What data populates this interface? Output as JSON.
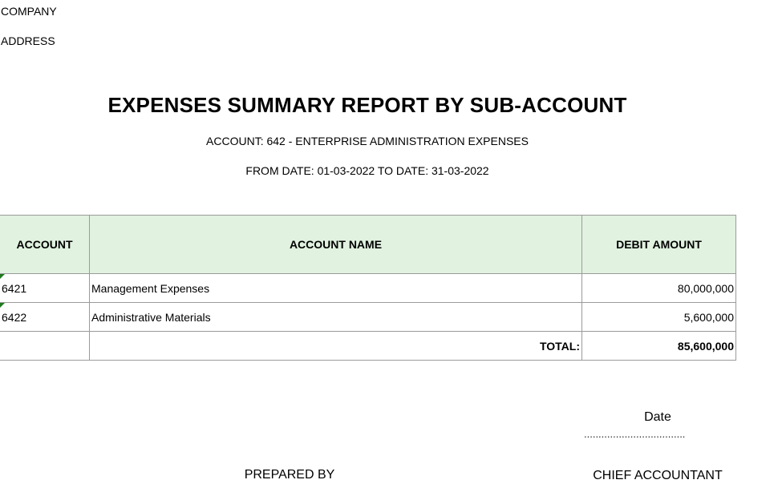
{
  "header": {
    "company": "COMPANY",
    "address": "ADDRESS",
    "title": "EXPENSES SUMMARY REPORT BY SUB-ACCOUNT",
    "account_line": "ACCOUNT: 642 - ENTERPRISE ADMINISTRATION EXPENSES",
    "date_line": "FROM DATE: 01-03-2022 TO DATE: 31-03-2022"
  },
  "table": {
    "columns": [
      "ACCOUNT",
      "ACCOUNT NAME",
      "DEBIT AMOUNT"
    ],
    "rows": [
      {
        "account": "6421",
        "name": "Management Expenses",
        "debit": "80,000,000"
      },
      {
        "account": "6422",
        "name": "Administrative Materials",
        "debit": "5,600,000"
      }
    ],
    "total_label": "TOTAL:",
    "total_value": "85,600,000"
  },
  "footer": {
    "date_label": "Date",
    "date_dots": "...................................",
    "prepared_by": "PREPARED BY",
    "chief_accountant": "CHIEF ACCOUNTANT"
  },
  "colors": {
    "header_fill": "#e1f2e0",
    "grid": "#9b9b9b",
    "cell_marker": "#1d7a1d"
  }
}
